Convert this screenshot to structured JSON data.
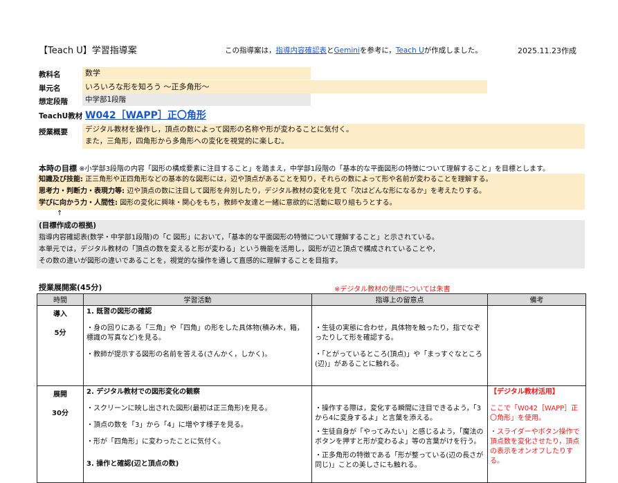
{
  "header": {
    "title": "【Teach U】学習指導案",
    "note_prefix": "この指導案は，",
    "note_link1": "指導内容確認表",
    "note_and": "と",
    "note_link2": "Gemini",
    "note_mid": "を参考に，",
    "note_link3": "Teach U",
    "note_suffix": "が作成しました。",
    "date": "2025.11.23作成"
  },
  "info": {
    "subject_label": "教科名",
    "subject": "数学",
    "unit_label": "単元名",
    "unit": "いろいろな形を知ろう 〜正多角形〜",
    "stage_label": "想定段階",
    "stage": "中学部1段階",
    "material_label": "TeachU教材",
    "material": "W042［WAPP］正〇角形",
    "overview_label": "授業概要",
    "overview_1": "デジタル教材を操作し，頂点の数によって図形の名称や形が変わることに気付く。",
    "overview_2": "また，三角形，四角形から多角形への変化を視覚的に楽しむ。"
  },
  "goals": {
    "title": "本時の目標",
    "title_note": "※小学部3段階の内容「図形の構成要素に注目すること」を踏まえ，中学部1段階の「基本的な平面図形の特徴について理解すること」を目標とします。",
    "k_label": "知識及び技能:",
    "k_text": "正三角形や正四角形などの基本的な図形には，辺や頂点があることを知り，それらの数によって形や名前が変わることを理解する。",
    "t_label": "思考力・判断力・表現力等:",
    "t_text": "辺や頂点の数に注目して図形を弁別したり，デジタル教材の変化を見て「次はどんな形になるか」を考えたりする。",
    "a_label": "学びに向かう力・人間性:",
    "a_text": "図形の変化に興味・関心をもち，教師や友達と一緒に意欲的に活動に取り組もうとする。",
    "arrow": "↑"
  },
  "basis": {
    "title": "(目標作成の根拠)",
    "line1": "指導内容確認表(数学・中学部1段階)の「C 図形」において，「基本的な平面図形の特徴について理解すること」と示されている。",
    "line2": "本単元では，デジタル教材の「頂点の数を変えると形が変わる」という機能を活用し，図形が辺と頂点で構成されていることや，",
    "line3": "その数の違いが図形の違いであることを，視覚的な操作を通して直感的に理解することを目指す。"
  },
  "plan": {
    "title": "授業展開案(45分)",
    "note": "※デジタル教材の使用については朱書",
    "headers": [
      "時間",
      "学習活動",
      "指導上の留意点",
      "備考"
    ],
    "r1": {
      "phase": "導入",
      "time": "5分",
      "heading": "1. 既習の図形の確認",
      "act1": "・身の回りにある「三角」や「四角」の形をした具体物(積み木，箱，標識の写真など)を見る。",
      "act2": "・教師が提示する図形の名前を答える(さんかく，しかく)。",
      "pt1": "・生徒の実態に合わせ，具体物を触ったり，指でなぞったりして形を確認する。",
      "pt2": "・「とがっているところ(頂点)」や「まっすぐなところ(辺)」があることに触れる。"
    },
    "r2": {
      "phase": "展開",
      "time": "30分",
      "heading": "2. デジタル教材での図形変化の観察",
      "act1": "・スクリーンに映し出された図形(最初は正三角形)を見る。",
      "act2": "・頂点の数を「3」から「4」に増やす様子を見る。",
      "act3": "・形が「四角形」に変わったことに気付く。",
      "heading2": "3. 操作と確認(辺と頂点の数)",
      "pt1": "・操作する際は，変化する瞬間に注目できるよう，「3から4に変身するよ」と言葉を添える。",
      "pt2": "・生徒自身が「やってみたい」と感じるよう，「魔法のボタンを押すと形が変わるよ」等の言葉がけを行う。",
      "pt3": "・正多角形の特徴である「形が整っている(辺の長さが同じ)」ことの美しさにも触れる。",
      "rm_title": "【デジタル教材活用】",
      "rm1": "ここで「W042［WAPP］正〇角形」を使用。",
      "rm2": "・スライダーやボタン操作で頂点数を変化させたり，頂点の表示をオンオフしたりする。"
    }
  },
  "colors": {
    "highlight": "#fdecc8",
    "gray": "#e8e8e8",
    "link": "#1a56c8",
    "red": "#e0201c"
  }
}
